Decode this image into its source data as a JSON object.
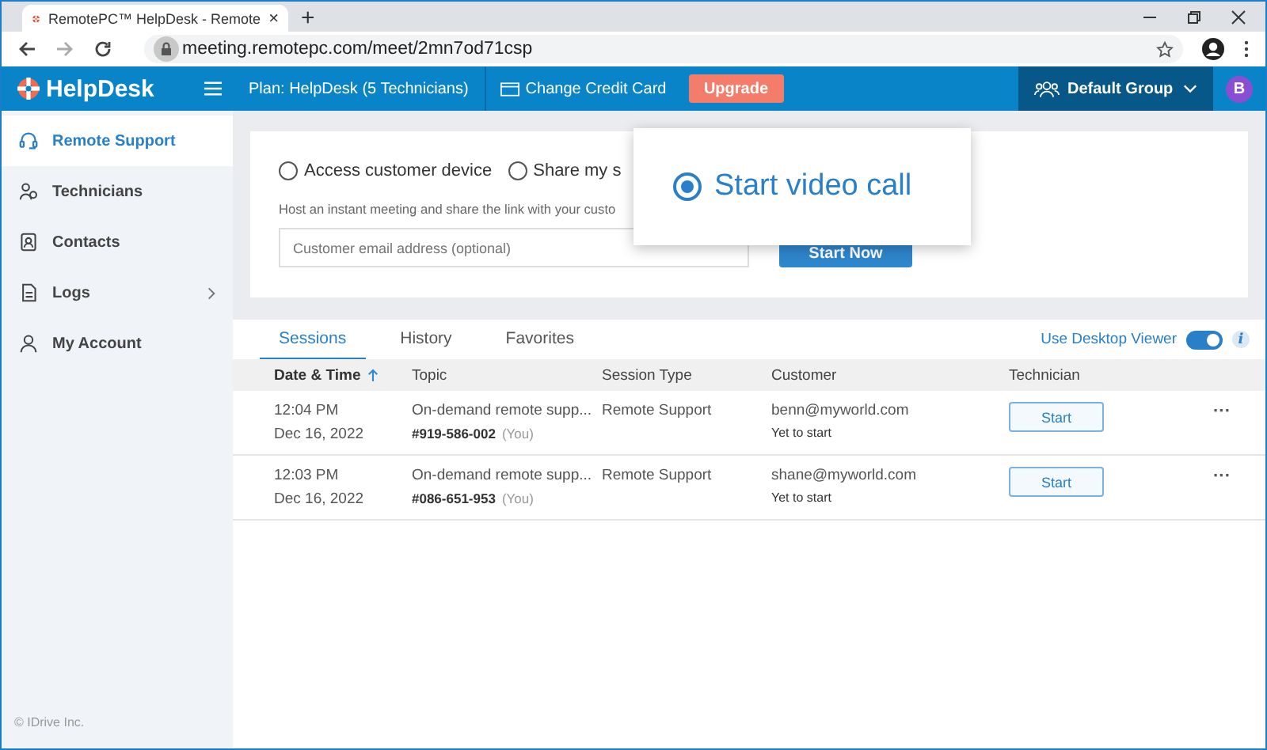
{
  "browser": {
    "tab_title": "RemotePC™ HelpDesk - Remote",
    "tab_close": "×",
    "new_tab": "+",
    "url": "meeting.remotepc.com/meet/2mn7od71csp"
  },
  "header": {
    "logo": "HelpDesk",
    "plan": "Plan: HelpDesk (5 Technicians)",
    "change_card": "Change Credit Card",
    "upgrade": "Upgrade",
    "group": "Default Group",
    "avatar": "B"
  },
  "sidebar": {
    "items": [
      {
        "label": "Remote Support",
        "selected": true,
        "has_children": false
      },
      {
        "label": "Technicians",
        "selected": false,
        "has_children": false
      },
      {
        "label": "Contacts",
        "selected": false,
        "has_children": false
      },
      {
        "label": "Logs",
        "selected": false,
        "has_children": true
      },
      {
        "label": "My Account",
        "selected": false,
        "has_children": false
      }
    ],
    "footer": "© IDrive Inc."
  },
  "session_options": [
    {
      "label": "Access customer device",
      "selected": false,
      "kind": "inline"
    },
    {
      "label": "Share my s",
      "selected": false,
      "kind": "inline"
    },
    {
      "label": "Start video call",
      "selected": true,
      "kind": "popup"
    }
  ],
  "instructions": "Host an instant meeting and share the link with your custo",
  "email_field": {
    "placeholder": "Customer email address (optional)"
  },
  "start_button": "Start Now",
  "tabs": [
    {
      "label": "Sessions",
      "selected": true
    },
    {
      "label": "History",
      "selected": false
    },
    {
      "label": "Favorites",
      "selected": false
    }
  ],
  "desktop_viewer": {
    "label": "Use Desktop Viewer",
    "on": true,
    "info": "i"
  },
  "table": {
    "columns": [
      {
        "label": "Date & Time",
        "sorted": true
      },
      {
        "label": "Topic",
        "sorted": false
      },
      {
        "label": "Session Type",
        "sorted": false
      },
      {
        "label": "Customer",
        "sorted": false
      },
      {
        "label": "Technician",
        "sorted": false
      }
    ],
    "rows": [
      {
        "time": "12:04 PM",
        "date": "Dec 16, 2022",
        "topic": "On-demand remote supp...",
        "session_id": "#919-586-002",
        "owner": "(You)",
        "type": "Remote Support",
        "customer": "benn@myworld.com",
        "status": "Yet to start",
        "action": "Start",
        "more": "···"
      },
      {
        "time": "12:03 PM",
        "date": "Dec 16, 2022",
        "topic": "On-demand remote supp...",
        "session_id": "#086-651-953",
        "owner": "(You)",
        "type": "Remote Support",
        "customer": "shane@myworld.com",
        "status": "Yet to start",
        "action": "Start",
        "more": "···"
      }
    ]
  }
}
